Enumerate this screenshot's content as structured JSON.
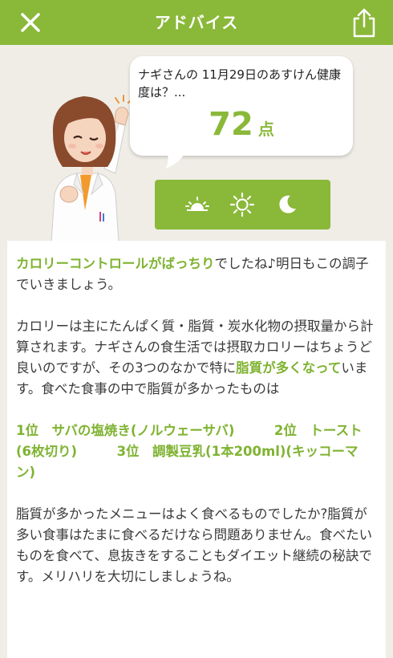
{
  "header": {
    "title": "アドバイス",
    "close_icon": "close-icon",
    "share_icon": "share-icon"
  },
  "bubble": {
    "question": "ナギさんの 11月29日のあすけん健康度は？...",
    "score": "72",
    "unit": "点"
  },
  "time_icons": [
    "sunrise-icon",
    "sun-icon",
    "moon-icon"
  ],
  "advice": {
    "p1_highlight": "カロリーコントロールがばっちり",
    "p1_rest": "でしたね♪明日もこの調子でいきましょう。",
    "p2_a": "カロリーは主にたんぱく質・脂質・炭水化物の摂取量から計算されます。ナギさんの食生活では摂取カロリーはちょうど良いのですが、その3つのなかで特に",
    "p2_highlight": "脂質が多くなって",
    "p2_b": "います。食べた食事の中で脂質が多かったものは",
    "ranking": "1位　サバの塩焼き(ノルウェーサバ)　　　2位　トースト(6枚切り)　　　3位　調製豆乳(1本200ml)(キッコーマン)",
    "p3": "脂質が多かったメニューはよく食べるものでしたか?脂質が多い食事はたまに食べるだけなら問題ありません。食べたいものを食べて、息抜きをすることもダイエット継続の秘訣です。メリハリを大切にしましょうね。"
  },
  "colors": {
    "accent": "#8ab839",
    "background": "#efede6",
    "highlight_text": "#7fb332"
  }
}
